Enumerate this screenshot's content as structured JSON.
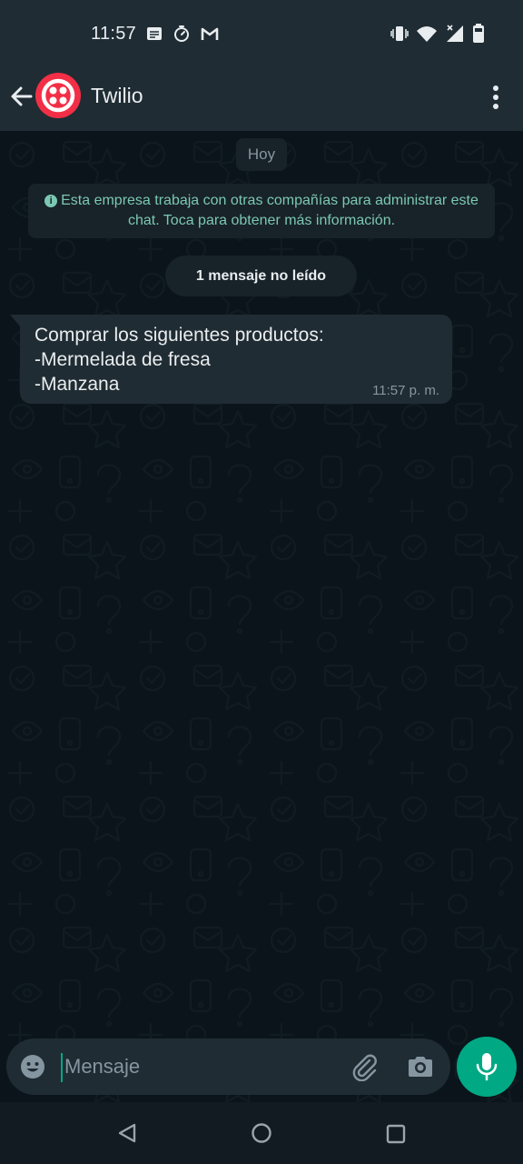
{
  "status_bar": {
    "time": "11:57",
    "icons_left": [
      "message-icon",
      "timer-icon",
      "gmail-icon"
    ],
    "icons_right": [
      "vibrate-icon",
      "wifi-icon",
      "signal-icon",
      "battery-icon"
    ]
  },
  "header": {
    "title": "Twilio",
    "avatar_color": "#f22f46"
  },
  "chat": {
    "date_label": "Hoy",
    "info_banner": "Esta empresa trabaja con otras compañías para administrar este chat. Toca para obtener más información.",
    "unread_label": "1 mensaje no leído",
    "messages": [
      {
        "lines": [
          "Comprar los siguientes productos:",
          "-Mermelada de fresa",
          "-Manzana"
        ],
        "time": "11:57 p. m."
      }
    ]
  },
  "composer": {
    "placeholder": "Mensaje",
    "accent_color": "#00a884"
  },
  "colors": {
    "background": "#0b141a",
    "bar": "#1f2c34",
    "info_text": "#7bc8b2"
  }
}
